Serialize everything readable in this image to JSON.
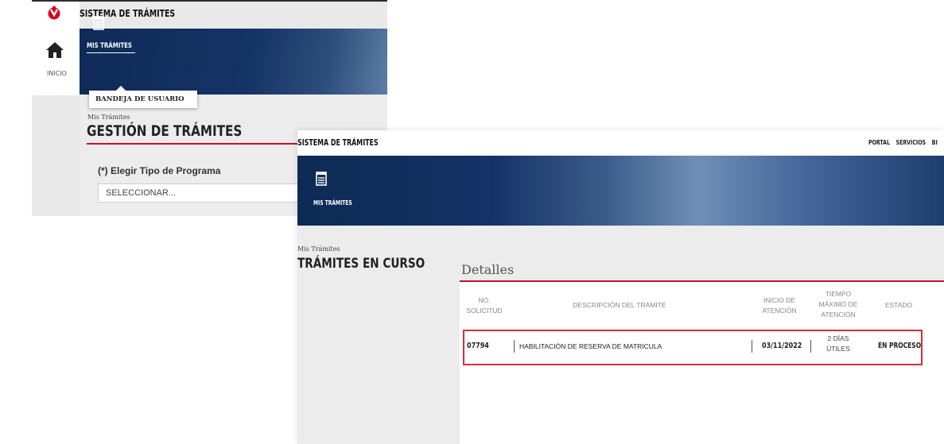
{
  "screen1": {
    "app_title": "SISTEMA DE TRÁMITES",
    "sidebar": {
      "home_icon": "home-icon",
      "home_label": "INICIO"
    },
    "banner": {
      "icon": "document-list-icon",
      "menu_label": "MIS TRÁMITES"
    },
    "dropdown": {
      "item_label": "BANDEJA DE USUARIO"
    },
    "breadcrumb": "Mis Trámites",
    "page_title": "GESTIÓN DE TRÁMITES",
    "form": {
      "program_label": "(*) Elegir Tipo de Programa",
      "program_value": "SELECCIONAR..."
    },
    "accent_color": "#c8102e",
    "brand_color": "#153466"
  },
  "screen2": {
    "app_title": "SISTEMA DE TRÁMITES",
    "top_nav": [
      "PORTAL",
      "SERVICIOS",
      "BI"
    ],
    "banner": {
      "icon": "document-list-icon",
      "menu_label": "MIS TRÁMITES"
    },
    "breadcrumb": "Mis Trámites",
    "page_title": "TRÁMITES EN CURSO",
    "details": {
      "title": "Detalles",
      "columns": {
        "no_solicitud": [
          "NO.",
          "SOLICITUD"
        ],
        "descripcion": "DESCRIPCIÓN DEL TRÁMITE",
        "inicio": [
          "INICIO DE",
          "ATENCIÓN"
        ],
        "tiempo": [
          "TIEMPO",
          "MÁXIMO DE",
          "ATENCIÓN"
        ],
        "estado": "ESTADO"
      },
      "rows": [
        {
          "no_solicitud": "07794",
          "descripcion": "HABILITACIÓN DE RESERVA DE MATRICULA",
          "inicio": "03/11/2022",
          "tiempo": [
            "2 DÍAS",
            "ÚTILES"
          ],
          "estado": "EN PROCESO"
        }
      ]
    }
  }
}
